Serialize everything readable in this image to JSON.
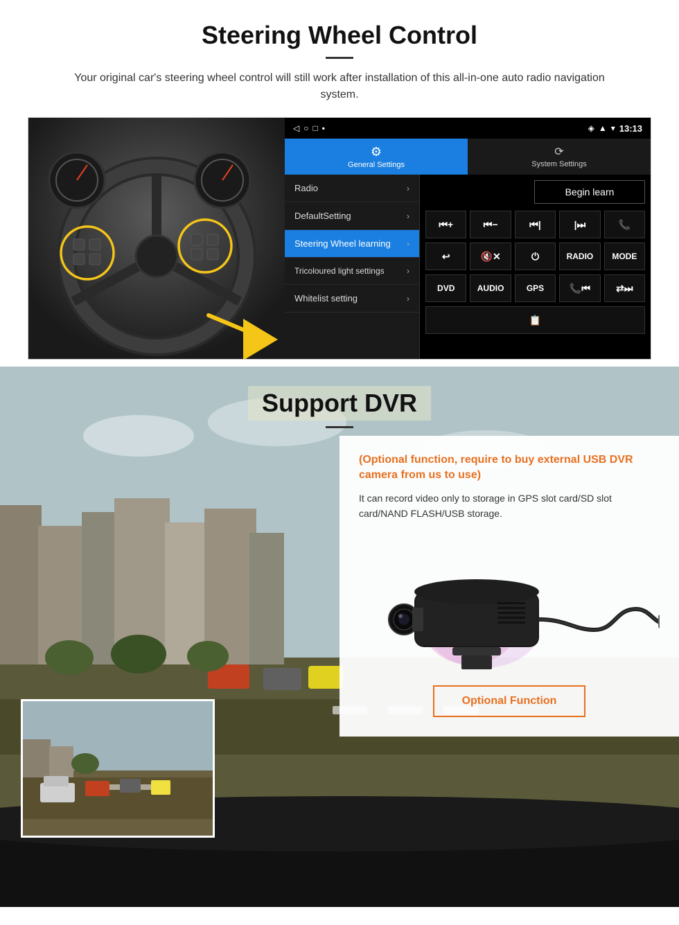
{
  "page": {
    "sections": {
      "steering": {
        "title": "Steering Wheel Control",
        "subtitle": "Your original car's steering wheel control will still work after installation of this all-in-one auto radio navigation system.",
        "android": {
          "statusbar": {
            "signal_icon": "▲",
            "wifi_icon": "▾",
            "time": "13:13"
          },
          "nav_icons": [
            "◁",
            "○",
            "□",
            "■"
          ],
          "tabs": {
            "general": {
              "icon": "⚙",
              "label": "General Settings"
            },
            "system": {
              "icon": "🔄",
              "label": "System Settings"
            }
          },
          "menu_items": [
            {
              "label": "Radio",
              "active": false
            },
            {
              "label": "DefaultSetting",
              "active": false
            },
            {
              "label": "Steering Wheel learning",
              "active": true
            },
            {
              "label": "Tricoloured light settings",
              "active": false
            },
            {
              "label": "Whitelist setting",
              "active": false
            }
          ],
          "begin_learn": "Begin learn",
          "control_buttons": [
            [
              "⏮+",
              "⏮-",
              "⏮|",
              "|⏭",
              "📞"
            ],
            [
              "↩",
              "🔇×",
              "⏻",
              "RADIO",
              "MODE"
            ],
            [
              "DVD",
              "AUDIO",
              "GPS",
              "📞⏮|",
              "🔀⏭|"
            ],
            [
              "📋"
            ]
          ]
        }
      },
      "dvr": {
        "title": "Support DVR",
        "optional_text": "(Optional function, require to buy external USB DVR camera from us to use)",
        "description": "It can record video only to storage in GPS slot card/SD slot card/NAND FLASH/USB storage.",
        "optional_button": "Optional Function"
      }
    }
  }
}
